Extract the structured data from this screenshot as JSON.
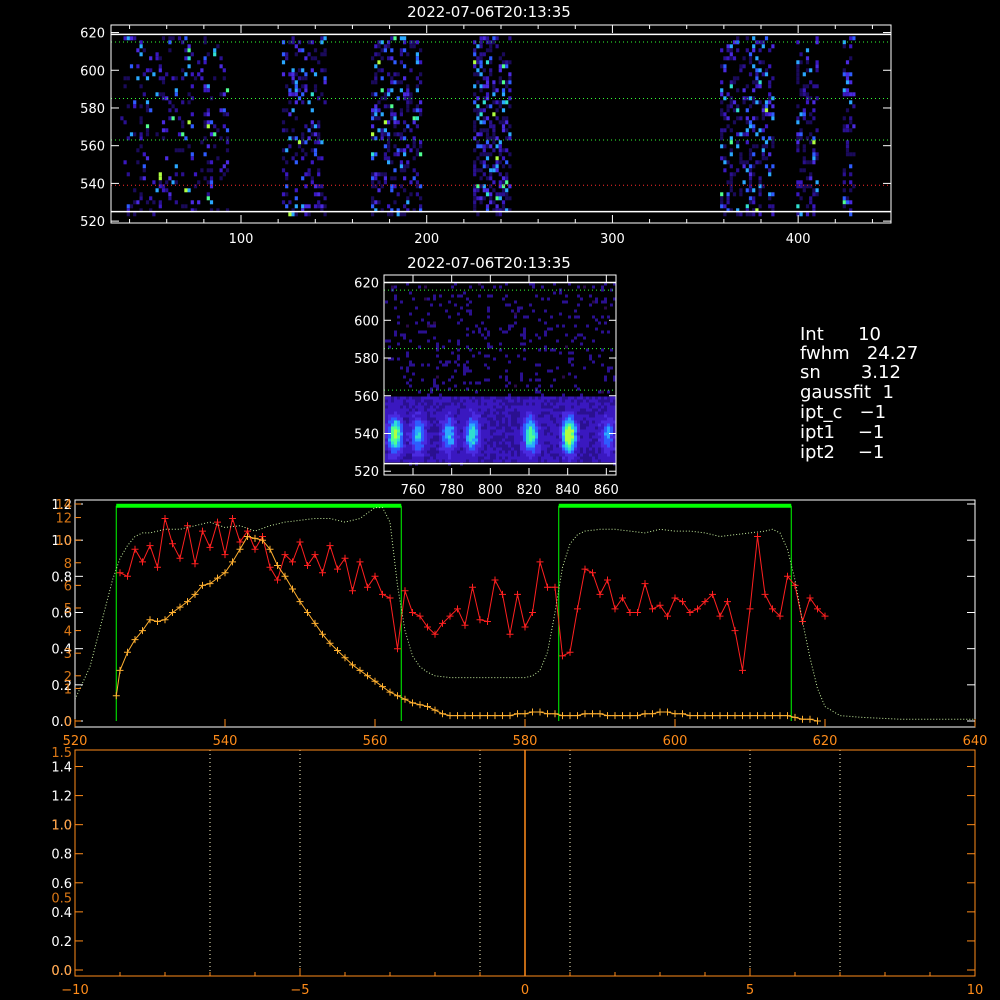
{
  "colors": {
    "axes_white": "#ffffff",
    "axes_orange": "#ff8c1a",
    "red_series": "#ff2020",
    "orange_series": "#ffb030",
    "green_dotted": "#c8f0a0",
    "green_box": "#00ff00",
    "guide_red": "#ff2a2a",
    "guide_green": "#33ff33"
  },
  "info": {
    "lines": [
      "Int      10",
      "fwhm   24.27",
      "sn       3.12",
      "gaussfit  1",
      "ipt_c   −1",
      "ipt1    −1",
      "ipt2    −1"
    ]
  },
  "chart_data": [
    {
      "type": "heatmap",
      "title": "2022-07-06T20:13:35",
      "xlim": [
        30,
        450
      ],
      "ylim": [
        519,
        624
      ],
      "x_ticks": [
        100,
        200,
        300,
        400
      ],
      "y_ticks": [
        520,
        540,
        560,
        580,
        600,
        620
      ],
      "x_tick_labels": [
        "100",
        "200",
        "300",
        "400"
      ],
      "y_tick_labels": [
        "520",
        "540",
        "560",
        "580",
        "600",
        "620"
      ],
      "bands_x": [
        [
          35,
          92
        ],
        [
          122,
          146
        ],
        [
          170,
          196
        ],
        [
          225,
          245
        ],
        [
          358,
          386
        ],
        [
          399,
          410
        ],
        [
          424,
          430
        ]
      ],
      "band_density": [
        0.28,
        0.5,
        0.55,
        0.8,
        0.55,
        0.5,
        0.6
      ],
      "guide_lines": [
        {
          "y": 619,
          "color": "white",
          "style": "solid"
        },
        {
          "y": 525,
          "color": "white",
          "style": "solid"
        },
        {
          "y": 539,
          "color": "red",
          "style": "dotted"
        },
        {
          "y": 563,
          "color": "green",
          "style": "dotted"
        },
        {
          "y": 585,
          "color": "green",
          "style": "dotted"
        },
        {
          "y": 615,
          "color": "green",
          "style": "dotted"
        }
      ]
    },
    {
      "type": "heatmap",
      "title": "2022-07-06T20:13:35",
      "xlim": [
        745,
        865
      ],
      "ylim": [
        518,
        624
      ],
      "x_ticks": [
        760,
        780,
        800,
        820,
        840,
        860
      ],
      "y_ticks": [
        520,
        540,
        560,
        580,
        600,
        620
      ],
      "x_tick_labels": [
        "760",
        "780",
        "800",
        "820",
        "840",
        "860"
      ],
      "y_tick_labels": [
        "520",
        "540",
        "560",
        "580",
        "600",
        "620"
      ],
      "blob_x": [
        750,
        762,
        778,
        790,
        820,
        840,
        860
      ],
      "blob_strength": [
        0.8,
        0.5,
        0.5,
        0.6,
        0.75,
        1.0,
        0.4
      ],
      "guide_lines": [
        {
          "y": 620,
          "color": "white",
          "style": "solid"
        },
        {
          "y": 524,
          "color": "white",
          "style": "solid"
        },
        {
          "y": 563,
          "color": "green",
          "style": "dotted"
        },
        {
          "y": 585,
          "color": "green",
          "style": "dotted"
        },
        {
          "y": 616,
          "color": "green",
          "style": "dotted"
        }
      ]
    },
    {
      "type": "line",
      "xlim": [
        520,
        640
      ],
      "ylim": [
        0,
        1.2
      ],
      "x_ticks": [
        520,
        540,
        560,
        580,
        600,
        620,
        640
      ],
      "x_tick_labels": [
        "520",
        "540",
        "560",
        "580",
        "600",
        "620",
        "640"
      ],
      "y_ticks_white": [
        0.0,
        0.2,
        0.4,
        0.6,
        0.8,
        1.0,
        1.2
      ],
      "y_tick_labels_white": [
        "0.0",
        "0.2",
        "0.4",
        "0.6",
        "0.8",
        "1.0",
        "1.2"
      ],
      "y_ticks_orange": [
        0.0,
        0.18,
        0.25,
        0.375,
        0.5,
        0.625,
        0.75,
        0.875,
        1.0,
        1.125,
        1.2
      ],
      "y_tick_labels_orange": [
        "0",
        "1",
        "2",
        "3",
        "4",
        "5",
        "6",
        "8",
        "10",
        "12",
        "14"
      ],
      "boxes": [
        {
          "x0": 525.5,
          "x1": 563.5,
          "y_top": 1.19
        },
        {
          "x0": 584.5,
          "x1": 615.5,
          "y_top": 1.19
        }
      ],
      "series": [
        {
          "color": "red",
          "marker": "plus",
          "x": [
            526,
            527,
            528,
            529,
            530,
            531,
            532,
            533,
            534,
            535,
            536,
            537,
            538,
            539,
            540,
            541,
            542,
            543,
            544,
            545,
            546,
            547,
            548,
            549,
            550,
            551,
            552,
            553,
            554,
            555,
            556,
            557,
            558,
            559,
            560,
            561,
            562,
            563,
            564,
            565,
            566,
            567,
            568,
            569,
            570,
            571,
            572,
            573,
            574,
            575,
            576,
            577,
            578,
            579,
            580,
            581,
            582,
            583,
            584,
            585,
            586,
            587,
            588,
            589,
            590,
            591,
            592,
            593,
            594,
            595,
            596,
            597,
            598,
            599,
            600,
            601,
            602,
            603,
            604,
            605,
            606,
            607,
            608,
            609,
            610,
            611,
            612,
            613,
            614,
            615,
            616,
            617,
            618,
            619,
            620
          ],
          "y": [
            0.82,
            0.8,
            0.95,
            0.88,
            0.97,
            0.85,
            1.12,
            0.98,
            0.9,
            1.08,
            0.87,
            1.05,
            0.96,
            1.1,
            0.92,
            1.12,
            0.99,
            1.05,
            0.95,
            1.02,
            0.85,
            0.78,
            0.92,
            0.88,
            0.99,
            0.86,
            0.92,
            0.82,
            0.97,
            0.84,
            0.9,
            0.72,
            0.88,
            0.74,
            0.8,
            0.7,
            0.68,
            0.4,
            0.72,
            0.6,
            0.58,
            0.52,
            0.48,
            0.54,
            0.58,
            0.62,
            0.53,
            0.74,
            0.56,
            0.55,
            0.78,
            0.7,
            0.48,
            0.7,
            0.52,
            0.6,
            0.88,
            0.74,
            0.74,
            0.36,
            0.38,
            0.62,
            0.84,
            0.82,
            0.7,
            0.78,
            0.62,
            0.68,
            0.6,
            0.6,
            0.76,
            0.62,
            0.64,
            0.58,
            0.68,
            0.66,
            0.6,
            0.62,
            0.66,
            0.7,
            0.58,
            0.66,
            0.5,
            0.28,
            0.62,
            1.02,
            0.7,
            0.62,
            0.58,
            0.8,
            0.75,
            0.55,
            0.68,
            0.62,
            0.58
          ]
        },
        {
          "color": "orange",
          "marker": "plus",
          "x": [
            525.5,
            526,
            527,
            528,
            529,
            530,
            531,
            532,
            533,
            534,
            535,
            536,
            537,
            538,
            539,
            540,
            541,
            542,
            543,
            544,
            545,
            546,
            547,
            548,
            549,
            550,
            551,
            552,
            553,
            554,
            555,
            556,
            557,
            558,
            559,
            560,
            561,
            562,
            563,
            564,
            565,
            566,
            567,
            568,
            569,
            570,
            571,
            572,
            573,
            574,
            575,
            576,
            577,
            578,
            579,
            580,
            581,
            582,
            583,
            584,
            585,
            586,
            587,
            588,
            589,
            590,
            591,
            592,
            593,
            594,
            595,
            596,
            597,
            598,
            599,
            600,
            601,
            602,
            603,
            604,
            605,
            606,
            607,
            608,
            609,
            610,
            611,
            612,
            613,
            614,
            615,
            616,
            617,
            618,
            619
          ],
          "y": [
            0.14,
            0.28,
            0.38,
            0.45,
            0.5,
            0.56,
            0.55,
            0.56,
            0.6,
            0.63,
            0.66,
            0.7,
            0.75,
            0.76,
            0.79,
            0.82,
            0.88,
            0.95,
            1.02,
            1.01,
            1.0,
            0.95,
            0.86,
            0.8,
            0.73,
            0.66,
            0.6,
            0.54,
            0.48,
            0.43,
            0.39,
            0.35,
            0.31,
            0.28,
            0.25,
            0.22,
            0.19,
            0.16,
            0.14,
            0.12,
            0.1,
            0.09,
            0.08,
            0.06,
            0.04,
            0.03,
            0.03,
            0.03,
            0.03,
            0.03,
            0.03,
            0.03,
            0.03,
            0.03,
            0.04,
            0.04,
            0.05,
            0.05,
            0.04,
            0.04,
            0.03,
            0.03,
            0.03,
            0.04,
            0.04,
            0.04,
            0.03,
            0.03,
            0.03,
            0.03,
            0.03,
            0.04,
            0.04,
            0.05,
            0.05,
            0.04,
            0.04,
            0.03,
            0.03,
            0.03,
            0.03,
            0.03,
            0.03,
            0.03,
            0.03,
            0.03,
            0.03,
            0.03,
            0.03,
            0.03,
            0.03,
            0.02,
            0.01,
            0.01,
            0.0
          ]
        },
        {
          "color": "green",
          "style": "dotted",
          "x": [
            520,
            522,
            524,
            525,
            526,
            527,
            528,
            529,
            530,
            532,
            534,
            536,
            538,
            540,
            542,
            544,
            546,
            548,
            550,
            552,
            554,
            556,
            558,
            560,
            561,
            562,
            563,
            564,
            565,
            566,
            567,
            568,
            570,
            572,
            574,
            576,
            578,
            580,
            581,
            582,
            583,
            584,
            585,
            586,
            587,
            588,
            590,
            592,
            594,
            596,
            598,
            600,
            602,
            604,
            606,
            608,
            610,
            612,
            613,
            614,
            615,
            616,
            617,
            618,
            619,
            620,
            622,
            625,
            630,
            635,
            640
          ],
          "y": [
            0.12,
            0.3,
            0.62,
            0.78,
            0.9,
            0.97,
            1.02,
            1.04,
            1.04,
            1.06,
            1.06,
            1.08,
            1.1,
            1.07,
            1.08,
            1.05,
            1.08,
            1.1,
            1.11,
            1.12,
            1.12,
            1.1,
            1.12,
            1.18,
            1.18,
            1.1,
            0.75,
            0.5,
            0.36,
            0.3,
            0.27,
            0.25,
            0.24,
            0.24,
            0.24,
            0.24,
            0.24,
            0.24,
            0.25,
            0.28,
            0.38,
            0.6,
            0.85,
            0.98,
            1.03,
            1.05,
            1.06,
            1.06,
            1.05,
            1.04,
            1.06,
            1.05,
            1.05,
            1.04,
            1.02,
            1.03,
            1.04,
            1.05,
            1.06,
            1.04,
            0.95,
            0.78,
            0.55,
            0.35,
            0.18,
            0.08,
            0.03,
            0.02,
            0.01,
            0.01,
            0.01
          ]
        }
      ]
    },
    {
      "type": "line",
      "xlim": [
        -10,
        10
      ],
      "ylim": [
        0,
        1.5
      ],
      "x_ticks": [
        -10,
        -5,
        0,
        5,
        10
      ],
      "x_tick_labels": [
        "−10",
        "−5",
        "0",
        "5",
        "10"
      ],
      "y_ticks_white": [
        0.0,
        0.2,
        0.4,
        0.6,
        0.8,
        1.0,
        1.2,
        1.4
      ],
      "y_tick_labels_white": [
        "0.0",
        "0.2",
        "0.4",
        "0.6",
        "0.8",
        "1.0",
        "1.2",
        "1.4"
      ],
      "y_ticks_orange": [
        0.0,
        0.5,
        1.0,
        1.5
      ],
      "y_tick_labels_orange": [
        "0.0",
        "0.5",
        "1.0",
        "1.5"
      ],
      "dotted_verticals_white": [
        -7,
        -5,
        -1,
        1,
        5,
        7
      ],
      "center_line_x": 0
    }
  ]
}
